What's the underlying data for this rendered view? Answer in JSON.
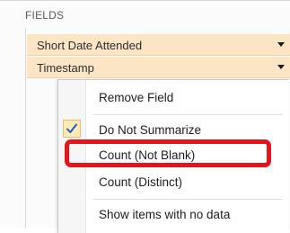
{
  "panel": {
    "header": "FIELDS",
    "fields": [
      {
        "label": "Short Date Attended"
      },
      {
        "label": "Timestamp"
      }
    ]
  },
  "context_menu": {
    "items": [
      {
        "label": "Remove Field",
        "checked": false
      },
      {
        "label": "Do Not Summarize",
        "checked": true
      },
      {
        "label": "Count (Not Blank)",
        "checked": false,
        "highlighted": true
      },
      {
        "label": "Count (Distinct)",
        "checked": false
      },
      {
        "label": "Show items with no data",
        "checked": false
      }
    ]
  },
  "colors": {
    "field_row_bg": "#fbe5c5",
    "highlight_border": "#e5141b",
    "check_color": "#1f5fbf"
  },
  "icons": {
    "dropdown": "chevron-down-icon",
    "check": "checkmark-icon"
  }
}
